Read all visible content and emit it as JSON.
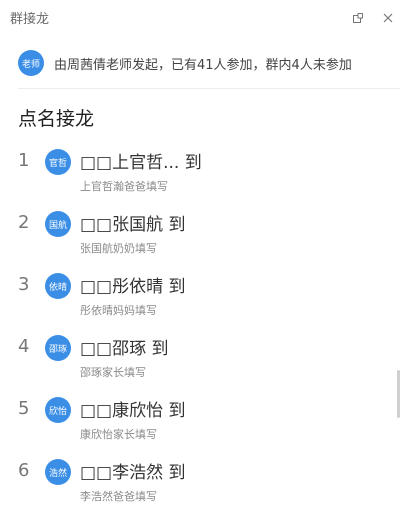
{
  "window": {
    "title": "群接龙"
  },
  "icons": {
    "pip": "picture-in-picture-icon",
    "close": "close-icon"
  },
  "announcement": {
    "badge": "老师",
    "text": "由周茜倩老师发起，已有41人参加，群内4人未参加"
  },
  "heading": "点名接龙",
  "entries": [
    {
      "num": "1",
      "avatar": "官哲",
      "name": "□□上官哲... 到",
      "sub": "上官哲瀚爸爸填写"
    },
    {
      "num": "2",
      "avatar": "国航",
      "name": "□□张国航 到",
      "sub": "张国航奶奶填写"
    },
    {
      "num": "3",
      "avatar": "依晴",
      "name": "□□彤依晴 到",
      "sub": "彤依晴妈妈填写"
    },
    {
      "num": "4",
      "avatar": "邵琢",
      "name": "□□邵琢 到",
      "sub": "邵琢家长填写"
    },
    {
      "num": "5",
      "avatar": "欣怡",
      "name": "□□康欣怡 到",
      "sub": "康欣怡家长填写"
    },
    {
      "num": "6",
      "avatar": "浩然",
      "name": "□□李浩然 到",
      "sub": "李浩然爸爸填写"
    }
  ],
  "colors": {
    "accent": "#3a8ee6",
    "text": "#333333",
    "muted": "#8a8a8a"
  }
}
